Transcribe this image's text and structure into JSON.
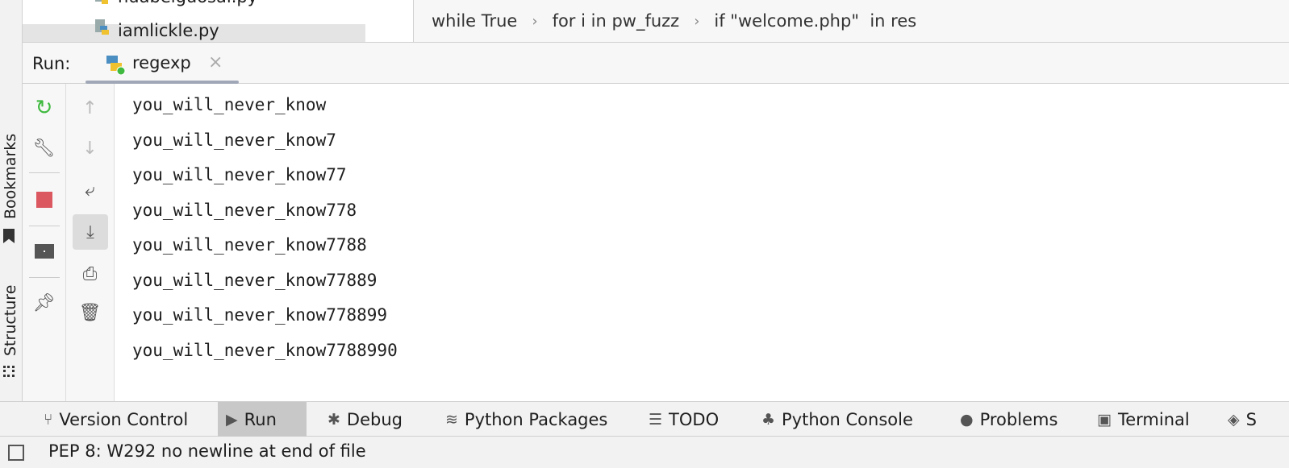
{
  "side_labels": {
    "bookmarks": "Bookmarks",
    "structure": "Structure"
  },
  "tree": {
    "items": [
      {
        "label": "huabeiguosai.py"
      },
      {
        "label": "iamlickle.py",
        "selected": true
      }
    ]
  },
  "breadcrumb": [
    "while True",
    "for i in pw_fuzz",
    "if \"welcome.php\"  in res"
  ],
  "run": {
    "label": "Run:",
    "tab": "regexp",
    "close": "×"
  },
  "console": [
    "you_will_never_know",
    "you_will_never_know7",
    "you_will_never_know77",
    "you_will_never_know778",
    "you_will_never_know7788",
    "you_will_never_know77889",
    "you_will_never_know778899",
    "you_will_never_know7788990"
  ],
  "toolwindows": [
    "Version Control",
    "Run",
    "Debug",
    "Python Packages",
    "TODO",
    "Python Console",
    "Problems",
    "Terminal",
    "S"
  ],
  "status": "PEP 8: W292 no newline at end of file",
  "colors": {
    "accent_green": "#3fb93f",
    "stop_red": "#db5860",
    "python_blue": "#4a8ec2",
    "python_yellow": "#f0c230"
  }
}
